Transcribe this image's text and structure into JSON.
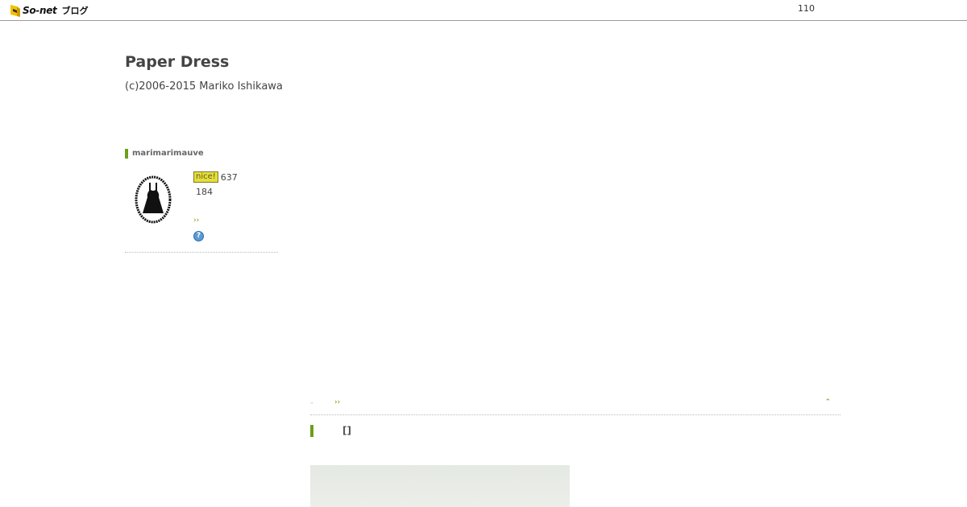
{
  "header": {
    "logo_text": "So-net",
    "logo_sub": "ブログ",
    "count": "110"
  },
  "blog": {
    "title": "Paper Dress",
    "description": "(c)2006-2015 Mariko Ishikawa"
  },
  "sidebar": {
    "profile_name": "marimarimauve",
    "nice_label": "nice!",
    "nice_count": "637",
    "follower_count": "184",
    "more_glyph": "››",
    "help_glyph": "?"
  },
  "main": {
    "nav_prev": "–",
    "nav_next": "››",
    "nav_top": "⌃",
    "entry_title": "[]"
  },
  "colors": {
    "accent_green": "#6d9f1a",
    "nice_yellow": "#e6de3a",
    "link_olive": "#8a8a00"
  }
}
